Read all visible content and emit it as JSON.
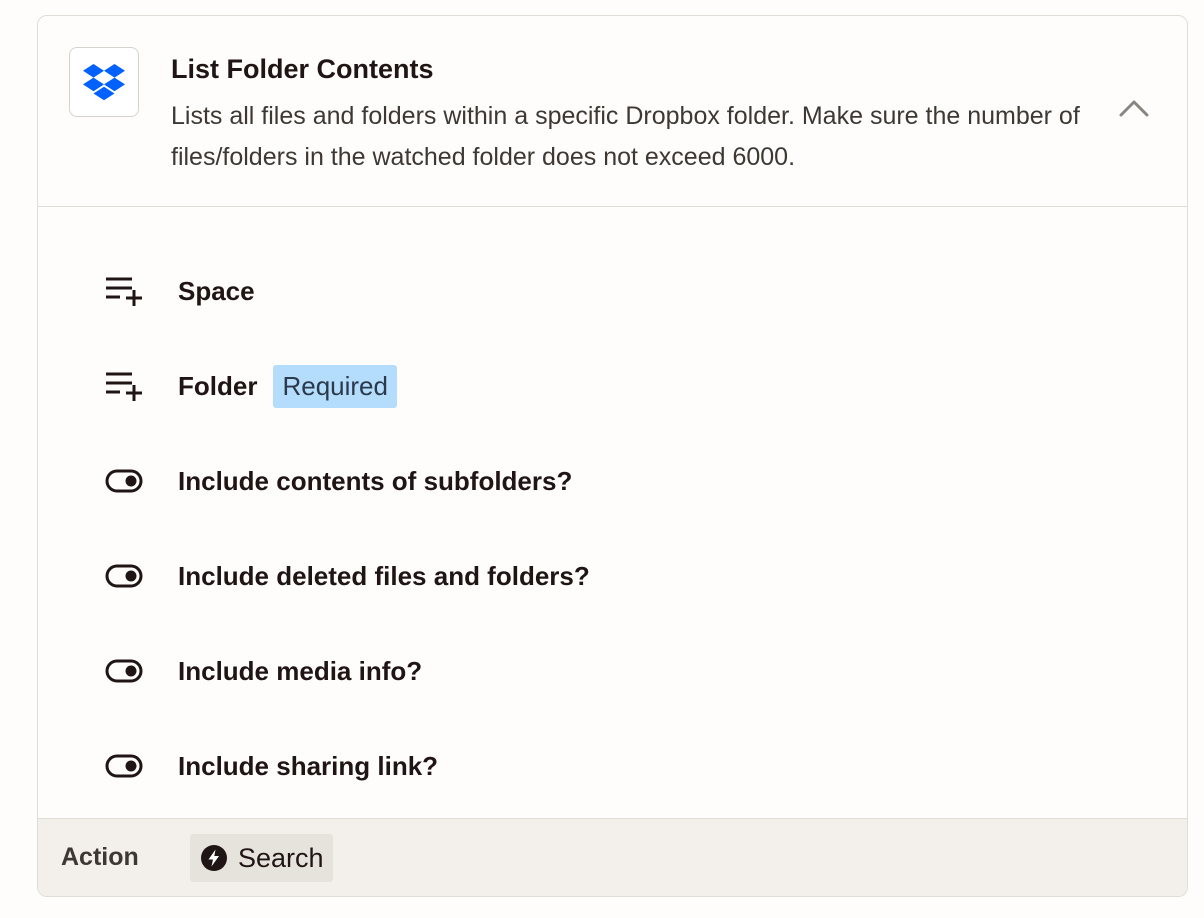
{
  "step": {
    "app_icon": "dropbox-logo",
    "title": "List Folder Contents",
    "description": "Lists all files and folders within a specific Dropbox folder. Make sure the number of files/folders in the watched folder does not exceed 6000.",
    "collapse_icon": "chevron-up-icon"
  },
  "fields": [
    {
      "label": "Space",
      "icon": "list-add-icon",
      "badge": null
    },
    {
      "label": "Folder",
      "icon": "list-add-icon",
      "badge": "Required"
    },
    {
      "label": "Include contents of subfolders?",
      "icon": "toggle-icon",
      "badge": null
    },
    {
      "label": "Include deleted files and folders?",
      "icon": "toggle-icon",
      "badge": null
    },
    {
      "label": "Include media info?",
      "icon": "toggle-icon",
      "badge": null
    },
    {
      "label": "Include sharing link?",
      "icon": "toggle-icon",
      "badge": null
    }
  ],
  "footer": {
    "label": "Action",
    "action_type": "Search",
    "action_icon": "bolt-circle-icon"
  },
  "colors": {
    "dropbox_blue": "#0061fe",
    "badge_bg": "#b3dcfd",
    "footer_bg": "#f3f0eb",
    "text": "#201515"
  }
}
